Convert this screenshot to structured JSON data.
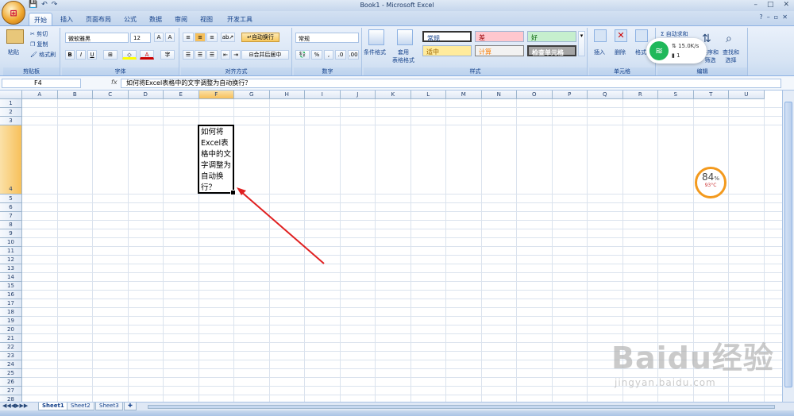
{
  "window": {
    "title": "Book1 - Microsoft Excel"
  },
  "tabs": [
    "开始",
    "插入",
    "页面布局",
    "公式",
    "数据",
    "审阅",
    "视图",
    "开发工具"
  ],
  "ribbon": {
    "clipboard": {
      "paste": "粘贴",
      "cut": "剪切",
      "copy": "复制",
      "format_painter": "格式刷",
      "label": "剪贴板"
    },
    "font": {
      "name": "微软雅黑",
      "size": "12",
      "label": "字体"
    },
    "alignment": {
      "wrap_text": "自动换行",
      "merge_center": "合并后居中",
      "label": "对齐方式"
    },
    "number": {
      "format": "常规",
      "label": "数字"
    },
    "styles": {
      "conditional": "条件格式",
      "table_format": "套用\n表格格式",
      "cells": [
        "常规",
        "差",
        "好",
        "适中",
        "计算",
        "检查单元格"
      ],
      "label": "样式"
    },
    "cells": {
      "insert": "插入",
      "delete": "删除",
      "format": "格式",
      "label": "单元格"
    },
    "editing": {
      "autosum": "自动求和",
      "sort_filter": "排序和\n筛选",
      "find_select": "查找和\n选择",
      "label": "编辑"
    }
  },
  "formula_bar": {
    "name_box": "F4",
    "fx": "fx",
    "content": "如何将Excel表格中的文字调整为自动换行？"
  },
  "columns": [
    "A",
    "B",
    "C",
    "D",
    "E",
    "F",
    "G",
    "H",
    "I",
    "J",
    "K",
    "L",
    "M",
    "N",
    "O",
    "P",
    "Q",
    "R",
    "S",
    "T",
    "U"
  ],
  "rows": [
    "1",
    "2",
    "3",
    "4",
    "5",
    "6",
    "7",
    "8",
    "9",
    "10",
    "11",
    "12",
    "13",
    "14",
    "15",
    "16",
    "17",
    "18",
    "19",
    "20",
    "21",
    "22",
    "23",
    "24",
    "25",
    "26",
    "27",
    "28"
  ],
  "active_cell": {
    "lines": [
      "如何将",
      "Excel表",
      "格中的文",
      "字调整为",
      "自动换",
      "行？"
    ]
  },
  "sheets": [
    "Sheet1",
    "Sheet2",
    "Sheet3"
  ],
  "overlays": {
    "wifi_speed": "15.0K/s",
    "wifi_count": "1",
    "cpu_percent": "84",
    "cpu_unit": "%",
    "cpu_temp": "93°C",
    "watermark_main": "Baidu经验",
    "watermark_url": "jingyan.baidu.com"
  },
  "colors": {
    "accent": "#f7c05a",
    "arrow": "#e02020",
    "wifi": "#1fb85a",
    "gauge": "#f39a1e"
  }
}
